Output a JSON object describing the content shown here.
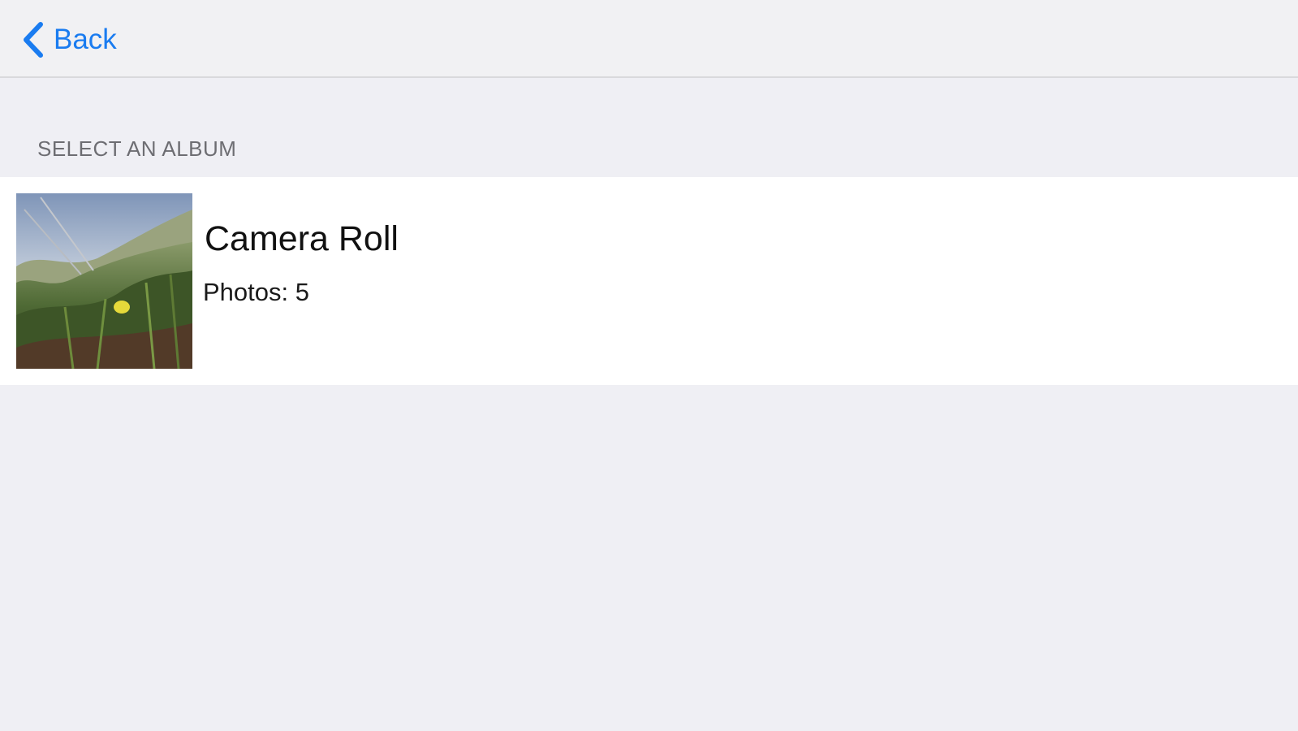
{
  "nav": {
    "back_label": "Back",
    "back_icon": "chevron-left-icon",
    "accent_color": "#1a7cf0"
  },
  "section": {
    "header": "SELECT AN ALBUM"
  },
  "albums": [
    {
      "title": "Camera Roll",
      "count_label": "Photos: 5",
      "thumbnail": "landscape-photo-thumbnail"
    }
  ]
}
